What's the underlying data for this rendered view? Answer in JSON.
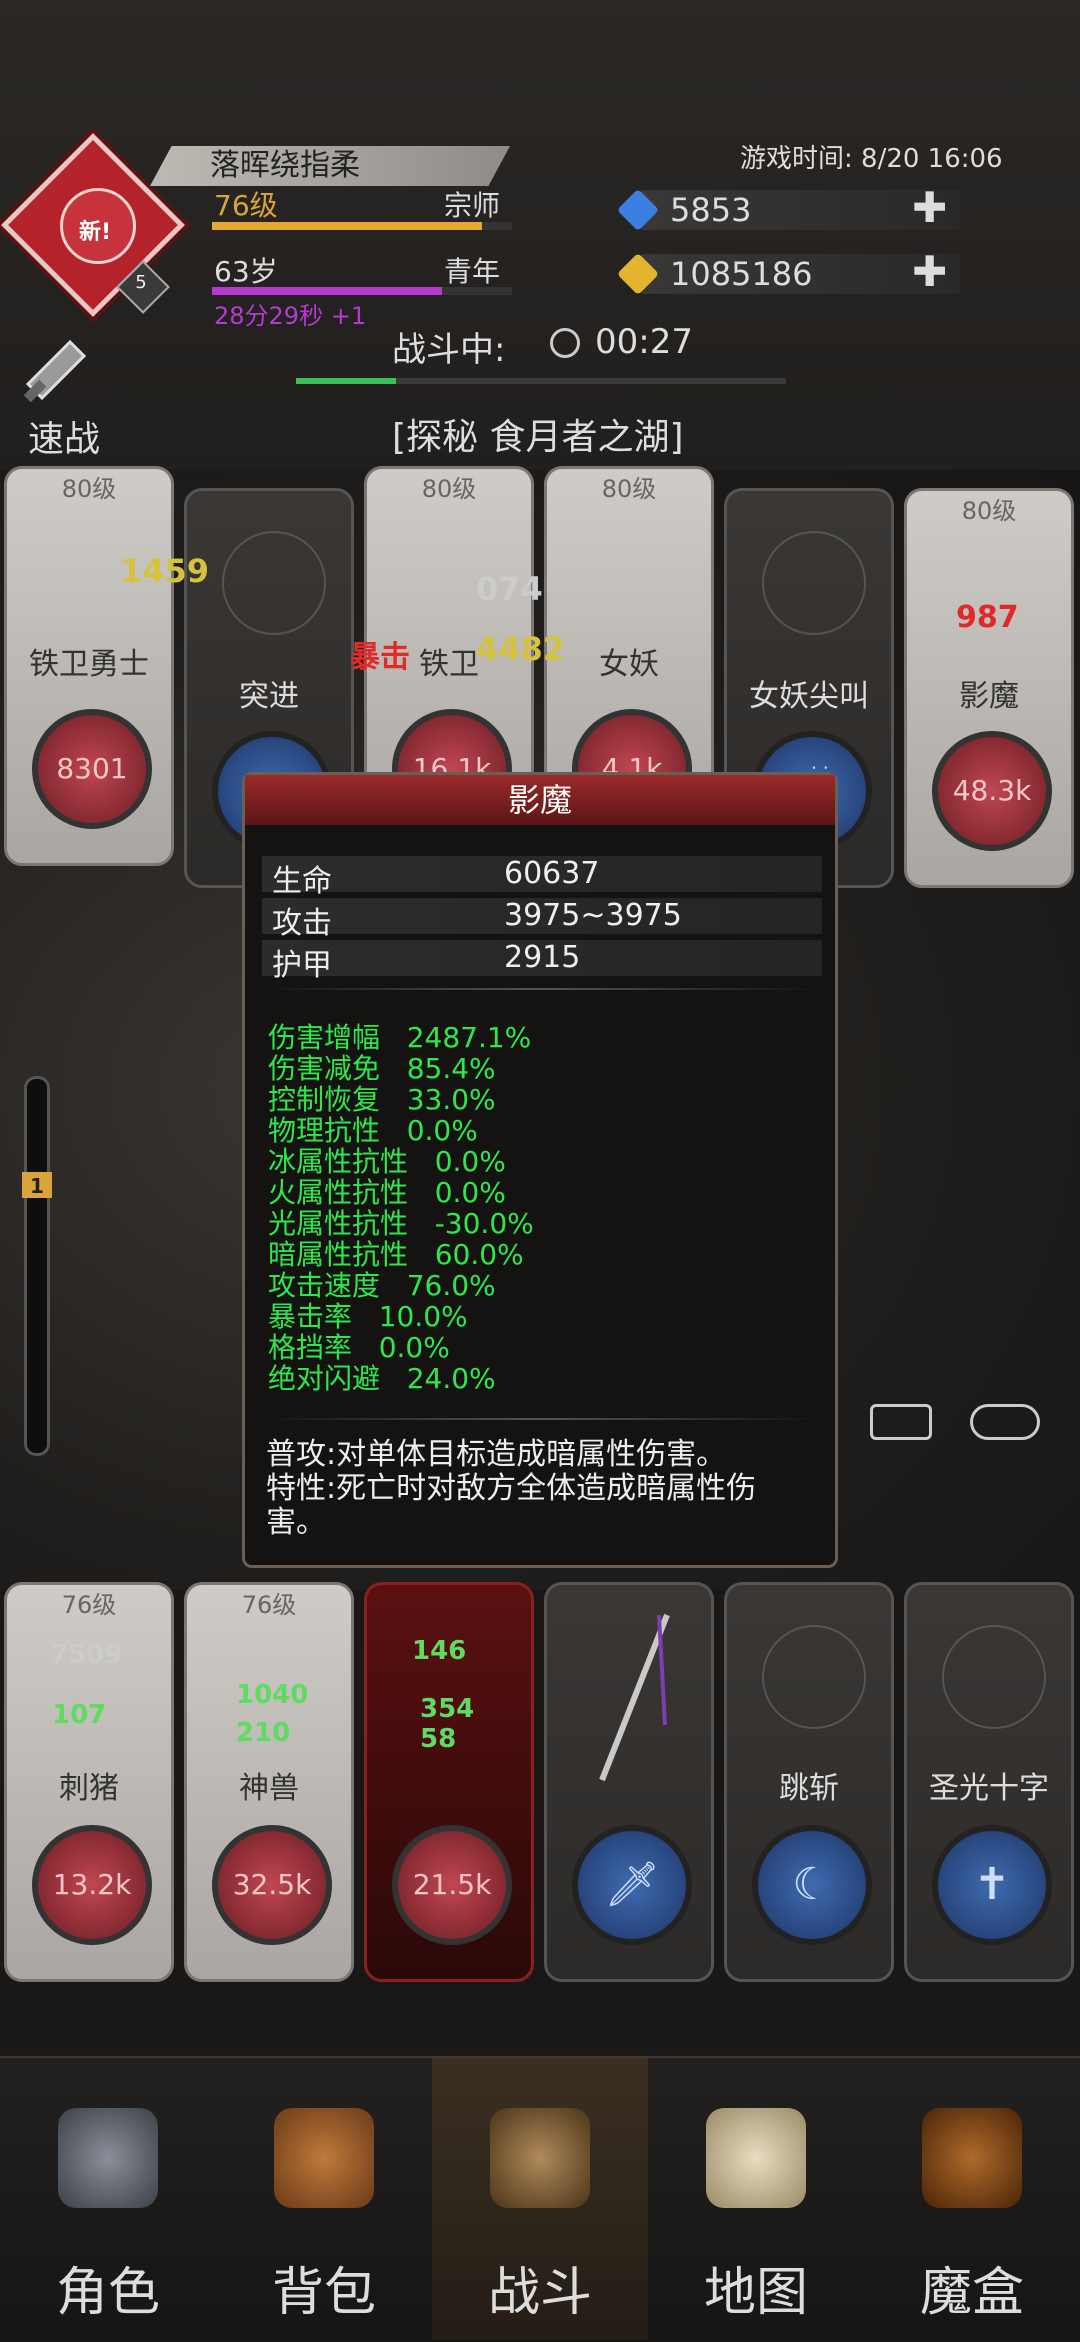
{
  "header": {
    "avatar_badge": "新!",
    "avatar_level_badge": "5",
    "player_name": "落晖绕指柔",
    "level": "76级",
    "rank": "宗师",
    "age": "63岁",
    "life_stage": "青年",
    "age_timer": "28分29秒 +1",
    "game_time": "游戏时间: 8/20 16:06",
    "diamonds": "5853",
    "gold": "1085186",
    "plus_symbol": "✚"
  },
  "battle": {
    "status_label": "战斗中:",
    "timer": "00:27",
    "quick_battle_label": "速战",
    "stage_name": "[探秘 食月者之湖]"
  },
  "enemy_row": [
    {
      "level": "80级",
      "name": "铁卫勇士",
      "hp": "8301"
    },
    {
      "name": "突进"
    },
    {
      "level": "80级",
      "name": "铁卫",
      "hp": "16.1k"
    },
    {
      "level": "80级",
      "name": "女妖",
      "hp": "4.1k"
    },
    {
      "name": "女妖尖叫"
    },
    {
      "level": "80级",
      "name": "影魔",
      "hp": "48.3k"
    }
  ],
  "float_numbers": {
    "n1": "1459",
    "n2": "4482",
    "n3": "074",
    "n4": "987",
    "crit": "暴击"
  },
  "popup": {
    "title": "影魔",
    "stats": [
      {
        "k": "生命",
        "v": "60637"
      },
      {
        "k": "攻击",
        "v": "3975~3975"
      },
      {
        "k": "护甲",
        "v": "2915"
      }
    ],
    "attrs": [
      "伤害增幅   2487.1%",
      "伤害减免   85.4%",
      "控制恢复   33.0%",
      "物理抗性   0.0%",
      "冰属性抗性   0.0%",
      "火属性抗性   0.0%",
      "光属性抗性   -30.0%",
      "暗属性抗性   60.0%",
      "攻击速度   76.0%",
      "暴击率   10.0%",
      "格挡率   0.0%",
      "绝对闪避   24.0%"
    ],
    "desc1": "普攻:对单体目标造成暗属性伤害。",
    "desc2": "特性:死亡时对敌方全体造成暗属性伤害。"
  },
  "gauge_value": "1",
  "ally_row": [
    {
      "level": "76级",
      "name": "刺猪",
      "hp": "13.2k"
    },
    {
      "level": "76级",
      "name": "神兽",
      "hp": "32.5k"
    },
    {
      "name": "",
      "hp": "21.5k"
    },
    {
      "name": ""
    },
    {
      "name": "跳斩"
    },
    {
      "name": "圣光十字"
    }
  ],
  "ally_floats": {
    "a1": "7509",
    "a2": "107",
    "a3": "1040",
    "a4": "210",
    "a5": "146",
    "a6": "354",
    "a7": "58"
  },
  "nav": [
    {
      "label": "角色",
      "icon": "helmet-icon"
    },
    {
      "label": "背包",
      "icon": "backpack-icon"
    },
    {
      "label": "战斗",
      "icon": "sword-shield-icon"
    },
    {
      "label": "地图",
      "icon": "scroll-map-icon"
    },
    {
      "label": "魔盒",
      "icon": "magic-box-icon"
    }
  ],
  "colors": {
    "accent_green": "#2ee84a",
    "level_gold": "#d9a53a",
    "age_purple": "#b63ad0",
    "hp_red": "#c04752"
  }
}
